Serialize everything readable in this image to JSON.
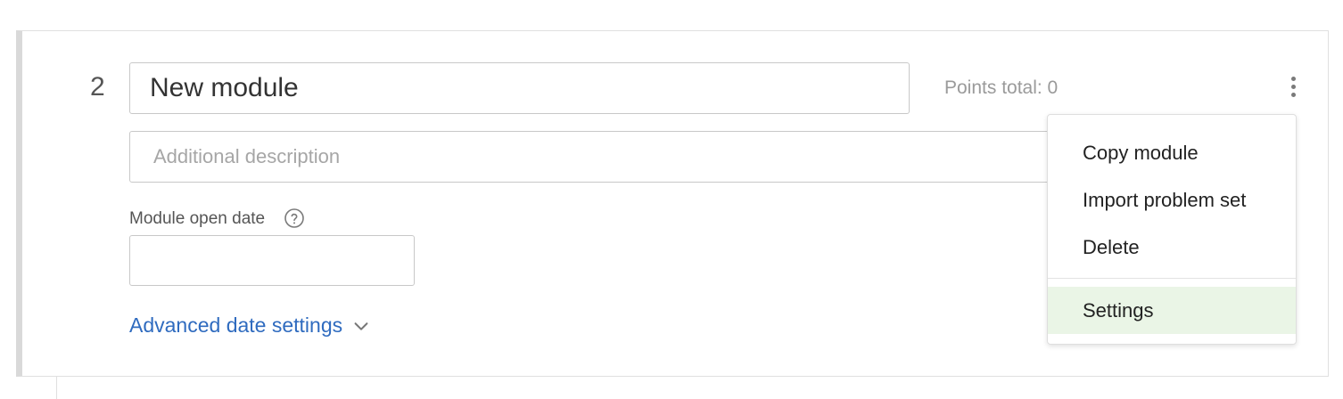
{
  "module": {
    "number": "2",
    "title_value": "New module",
    "points_total": "Points total: 0",
    "description_placeholder": "Additional description",
    "open_date_label": "Module open date",
    "open_date_value": "",
    "advanced_link": "Advanced date settings"
  },
  "menu": {
    "items": [
      {
        "label": "Copy module"
      },
      {
        "label": "Import problem set"
      },
      {
        "label": "Delete"
      },
      {
        "label": "Settings"
      }
    ],
    "highlighted_item": "Settings"
  },
  "colors": {
    "link": "#2f6bbf",
    "highlight": "#eaf5e6",
    "card_left_border": "#d9d9d9"
  },
  "icons": {
    "more": "vertical-ellipsis",
    "help": "question-circle",
    "advanced": "chevron-down"
  }
}
